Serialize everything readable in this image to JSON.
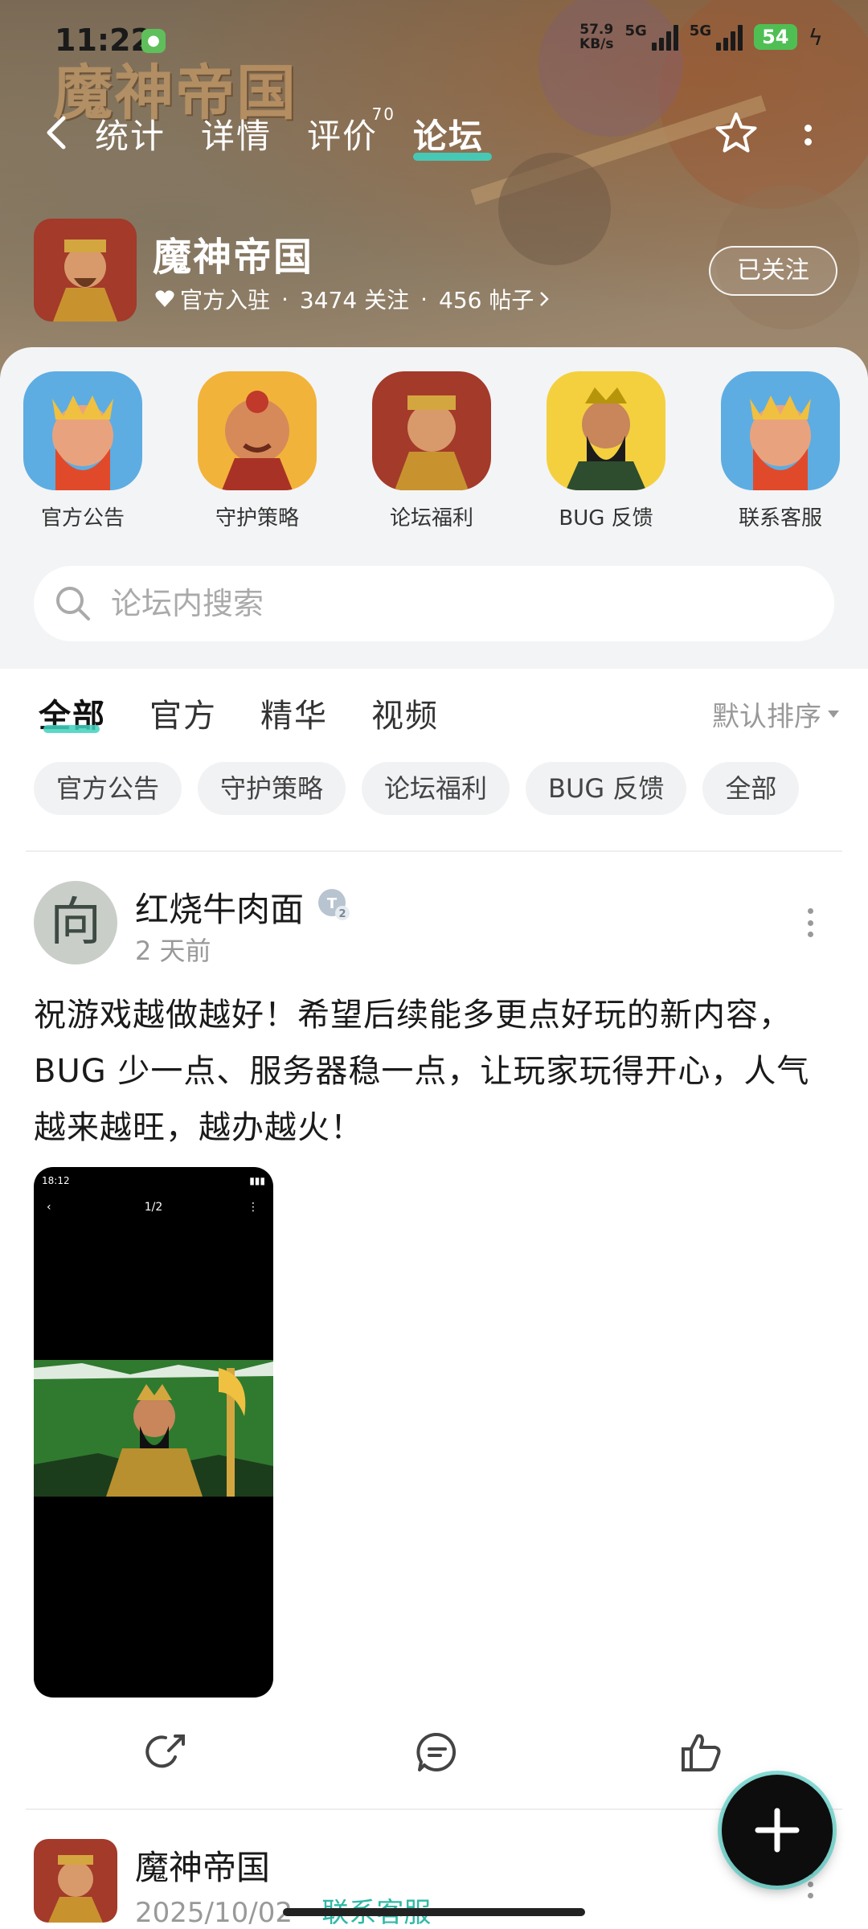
{
  "status_bar": {
    "time": "11:22",
    "net_speed_value": "57.9",
    "net_speed_unit": "KB/s",
    "sim1": "5G",
    "sim2": "5G",
    "battery": "54"
  },
  "banner": {
    "logo_text": "魔神帝国"
  },
  "nav": {
    "tabs": [
      {
        "label": "统计"
      },
      {
        "label": "详情"
      },
      {
        "label": "评价",
        "badge": "70"
      },
      {
        "label": "论坛"
      }
    ],
    "active_tab": "论坛"
  },
  "game": {
    "title": "魔神帝国",
    "official": "官方入驻",
    "followers": "3474 关注",
    "posts": "456 帖子",
    "follow_label": "已关注"
  },
  "categories": [
    {
      "label": "官方公告"
    },
    {
      "label": "守护策略"
    },
    {
      "label": "论坛福利"
    },
    {
      "label": "BUG 反馈"
    },
    {
      "label": "联系客服"
    }
  ],
  "search": {
    "placeholder": "论坛内搜索"
  },
  "filter_tabs": [
    {
      "label": "全部"
    },
    {
      "label": "官方"
    },
    {
      "label": "精华"
    },
    {
      "label": "视频"
    }
  ],
  "sort_label": "默认排序",
  "chips": [
    {
      "label": "官方公告"
    },
    {
      "label": "守护策略"
    },
    {
      "label": "论坛福利"
    },
    {
      "label": "BUG 反馈"
    },
    {
      "label": "全部"
    }
  ],
  "post": {
    "avatar_char": "向",
    "author": "红烧牛肉面",
    "time": "2 天前",
    "text": "祝游戏越做越好！希望后续能多更点好玩的新内容，BUG 少一点、服务器稳一点，让玩家玩得开心，人气越来越旺，越办越火！",
    "image": {
      "status_time": "18:12",
      "page_indicator": "1/2"
    }
  },
  "post2": {
    "author": "魔神帝国",
    "date": "2025/10/02",
    "separator": "·",
    "tag": "联系客服"
  },
  "colors": {
    "accent": "#3fd1c0",
    "tag": "#2fb9a6",
    "panel_bg": "#f3f4f6"
  }
}
